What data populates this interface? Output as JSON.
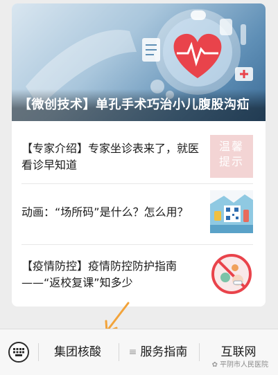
{
  "hero": {
    "title": "【微创技术】单孔手术巧治小儿腹股沟疝"
  },
  "articles": [
    {
      "title": "【专家介绍】专家坐诊表来了，就医看诊早知道",
      "thumb_text_1": "温馨",
      "thumb_text_2": "提示"
    },
    {
      "title": "动画：“场所码”是什么？怎么用？"
    },
    {
      "title": "【疫情防控】疫情防控防护指南——“返校复课”知多少"
    }
  ],
  "menu": {
    "item1": "集团核酸",
    "item2": "服务指南",
    "item3": "互联网"
  },
  "watermark": "平阴市人民医院",
  "colors": {
    "accent_orange": "#f2a33a",
    "hero_red": "#e9434b"
  }
}
